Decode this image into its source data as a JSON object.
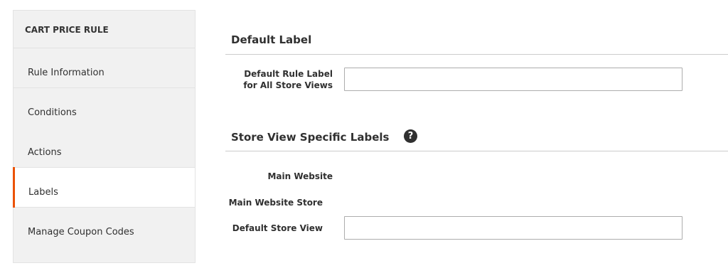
{
  "sidebar": {
    "title": "CART PRICE RULE",
    "items": [
      {
        "label": "Rule Information"
      },
      {
        "label": "Conditions"
      },
      {
        "label": "Actions"
      },
      {
        "label": "Labels"
      },
      {
        "label": "Manage Coupon Codes"
      }
    ]
  },
  "default_label": {
    "title": "Default Label",
    "field_label_line1": "Default Rule Label",
    "field_label_line2": "for All Store Views",
    "value": ""
  },
  "store_labels": {
    "title": "Store View Specific Labels",
    "help_icon": "?",
    "website": "Main Website",
    "store": "Main Website Store",
    "view_label": "Default Store View",
    "view_value": ""
  },
  "colors": {
    "accent": "#eb5202"
  }
}
